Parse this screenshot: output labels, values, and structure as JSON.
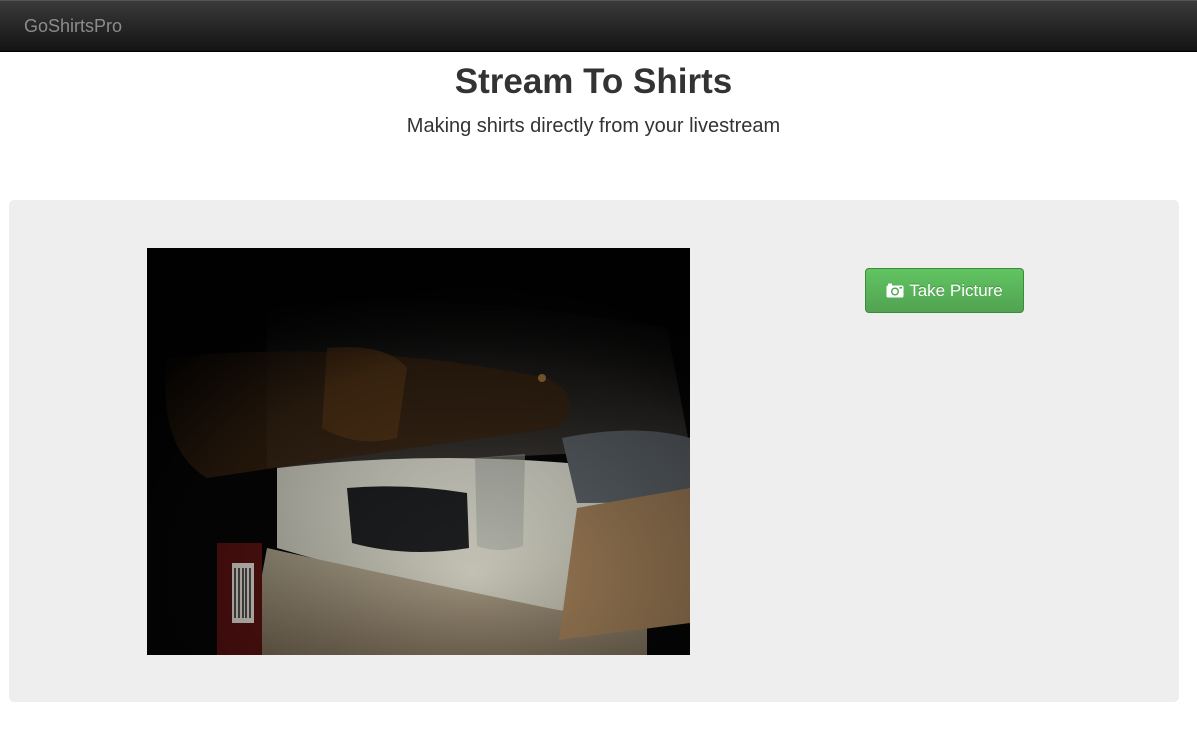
{
  "navbar": {
    "brand": "GoShirtsPro"
  },
  "header": {
    "title": "Stream To Shirts",
    "subtitle": "Making shirts directly from your livestream"
  },
  "capture": {
    "button_label": "Take Picture",
    "button_icon": "camera-icon"
  },
  "colors": {
    "button_green": "#51a351",
    "well_background": "#eeeeee",
    "navbar_dark": "#1b1b1b"
  }
}
